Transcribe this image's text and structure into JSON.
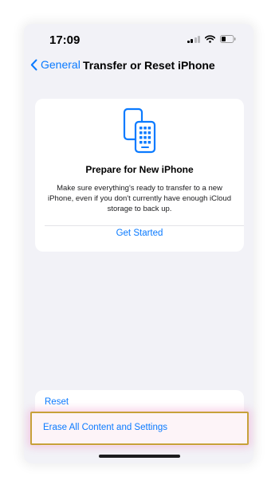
{
  "status_bar": {
    "time": "17:09",
    "icons": [
      "cellular-signal-icon",
      "wifi-icon",
      "battery-icon"
    ]
  },
  "nav": {
    "back_label": "General",
    "title": "Transfer or Reset iPhone"
  },
  "prepare_card": {
    "icon": "two-phones-icon",
    "title": "Prepare for New iPhone",
    "description": "Make sure everything's ready to transfer to a new iPhone, even if you don't currently have enough iCloud storage to back up.",
    "action_label": "Get Started"
  },
  "reset_section": {
    "reset_label": "Reset",
    "erase_label": "Erase All Content and Settings"
  },
  "colors": {
    "accent": "#0a7aff",
    "background": "#f2f2f7",
    "highlight_border": "#c7a13a"
  }
}
